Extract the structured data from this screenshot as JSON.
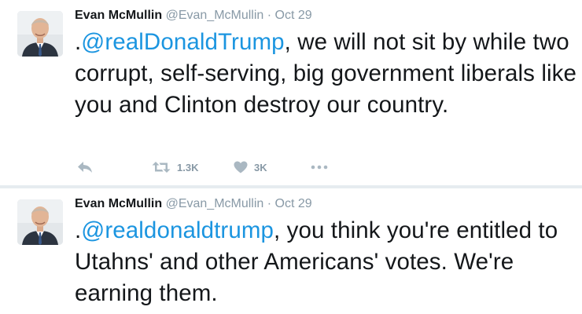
{
  "colors": {
    "name": "#14171a",
    "meta": "#8899a6",
    "mention": "#1b95e0",
    "divider": "#e6ecf0"
  },
  "tweets": [
    {
      "author_name": "Evan McMullin",
      "author_handle": "@Evan_McMullin",
      "separator": "·",
      "time": "Oct 29",
      "avatar_icon": "profile-photo",
      "text_prefix": ".",
      "mention": "@realDonaldTrump",
      "text_rest": ", we will not sit by while two corrupt, self-serving, big government liberals like you and Clinton destroy our country.",
      "actions": {
        "reply_icon": "reply-icon",
        "retweet_icon": "retweet-icon",
        "retweet_count": "1.3K",
        "like_icon": "heart-icon",
        "like_count": "3K",
        "more_icon": "more-dots-icon"
      }
    },
    {
      "author_name": "Evan McMullin",
      "author_handle": "@Evan_McMullin",
      "separator": "·",
      "time": "Oct 29",
      "avatar_icon": "profile-photo",
      "text_prefix": ".",
      "mention": "@realdonaldtrump",
      "text_rest": ", you think you're entitled to Utahns' and other Americans' votes. We're earning them."
    }
  ]
}
